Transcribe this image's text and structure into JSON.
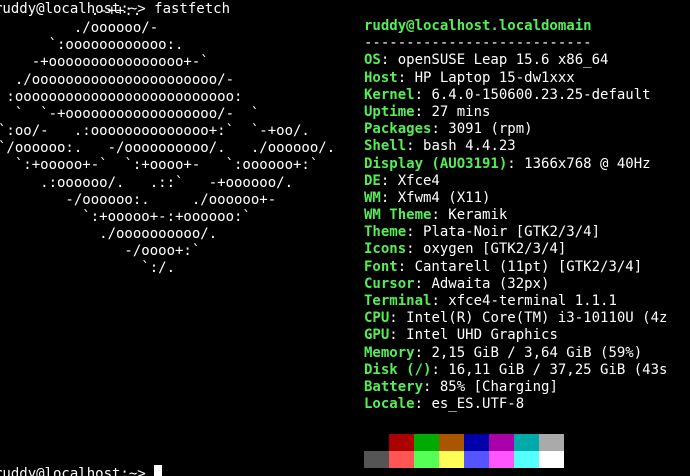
{
  "terminal": {
    "prompt_top": "ruddy@localhost:~> fastfetch",
    "prompt_bottom": "ruddy@localhost:~> "
  },
  "logo_ascii": "           .-++:.\n         ./oooooo/-\n      `:oooooooooooo:.\n    -+oooooooooooooooo+-`\n  ./oooooooooooooooooooooo/-\n :oooooooooooooooooooooooooo:\n  `  `-+oooooooooooooooooo/-  `\n`:oo/-   .:oooooooooooooo+:`  `-+oo/.\n`/oooooo:.   -/oooooooooo/.   ./oooooo/.\n  `:+ooooo+-`  `:+oooo+-   `:oooooo+:`\n     .:oooooo/.   .::`   -+oooooo/.\n        -/oooooo:.     ./oooooo+-\n          `:+ooooo+-:+oooooo:`\n            ./oooooooooo/.\n               -/oooo+:`\n                 `:/.",
  "info": {
    "title": "ruddy@localhost.localdomain",
    "separator": "---------------------------",
    "rows": [
      {
        "key": "OS",
        "value": "openSUSE Leap 15.6 x86_64"
      },
      {
        "key": "Host",
        "value": "HP Laptop 15-dw1xxx"
      },
      {
        "key": "Kernel",
        "value": "6.4.0-150600.23.25-default"
      },
      {
        "key": "Uptime",
        "value": "27 mins"
      },
      {
        "key": "Packages",
        "value": "3091 (rpm)"
      },
      {
        "key": "Shell",
        "value": "bash 4.4.23"
      },
      {
        "key": "Display (AUO3191)",
        "value": "1366x768 @ 40Hz"
      },
      {
        "key": "DE",
        "value": "Xfce4"
      },
      {
        "key": "WM",
        "value": "Xfwm4 (X11)"
      },
      {
        "key": "WM Theme",
        "value": "Keramik"
      },
      {
        "key": "Theme",
        "value": "Plata-Noir [GTK2/3/4]"
      },
      {
        "key": "Icons",
        "value": "oxygen [GTK2/3/4]"
      },
      {
        "key": "Font",
        "value": "Cantarell (11pt) [GTK2/3/4]"
      },
      {
        "key": "Cursor",
        "value": "Adwaita (32px)"
      },
      {
        "key": "Terminal",
        "value": "xfce4-terminal 1.1.1"
      },
      {
        "key": "CPU",
        "value": "Intel(R) Core(TM) i3-10110U (4z"
      },
      {
        "key": "GPU",
        "value": "Intel UHD Graphics"
      },
      {
        "key": "Memory",
        "value": "2,15 GiB / 3,64 GiB (59%)"
      },
      {
        "key": "Disk (/)",
        "value": "16,11 GiB / 37,25 GiB (43s"
      },
      {
        "key": "Battery",
        "value": "85% [Charging]"
      },
      {
        "key": "Locale",
        "value": "es_ES.UTF-8"
      }
    ]
  },
  "palette": {
    "normal": [
      "#000000",
      "#aa0000",
      "#00aa00",
      "#aa5500",
      "#0000aa",
      "#aa00aa",
      "#00aaaa",
      "#aaaaaa"
    ],
    "bright": [
      "#555555",
      "#ff5555",
      "#55ff55",
      "#ffff55",
      "#5555ff",
      "#ff55ff",
      "#55ffff",
      "#ffffff"
    ]
  },
  "colors": {
    "background": "#000000",
    "foreground": "#ffffff",
    "key": "#55ee55"
  }
}
